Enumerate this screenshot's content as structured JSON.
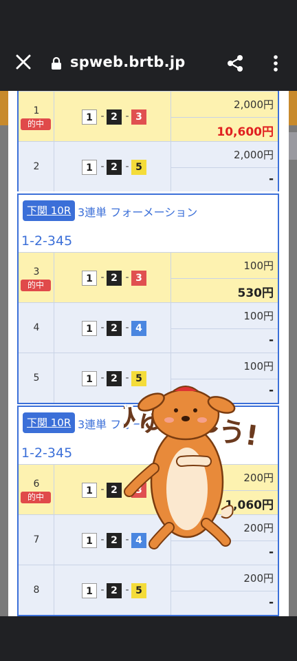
{
  "browser": {
    "domain": "spweb.brtb.jp",
    "close_icon": "close-icon",
    "lock_icon": "lock-icon",
    "share_icon": "share-icon",
    "more_icon": "more-vert-icon"
  },
  "colors": {
    "accent": "#3b6fd8",
    "hit_bg": "#fdf2b0",
    "nohit_bg": "#e9eef8",
    "hit_badge": "#e04a4a",
    "red_payout": "#e02020"
  },
  "groups": [
    {
      "race_button": "",
      "bet_type": "",
      "combo": "",
      "rows": [
        {
          "no": "1",
          "hit_label": "的中",
          "boxes": [
            "1",
            "2",
            "3"
          ],
          "bet": "2,000円",
          "payout": "10,600円"
        },
        {
          "no": "2",
          "hit_label": "",
          "boxes": [
            "1",
            "2",
            "5"
          ],
          "bet": "2,000円",
          "payout": "-"
        }
      ]
    },
    {
      "race_button": "下関 10R",
      "bet_type": "3連単 フォーメーション",
      "combo": "1-2-345",
      "rows": [
        {
          "no": "3",
          "hit_label": "的中",
          "boxes": [
            "1",
            "2",
            "3"
          ],
          "bet": "100円",
          "payout": "530円"
        },
        {
          "no": "4",
          "hit_label": "",
          "boxes": [
            "1",
            "2",
            "4"
          ],
          "bet": "100円",
          "payout": "-"
        },
        {
          "no": "5",
          "hit_label": "",
          "boxes": [
            "1",
            "2",
            "5"
          ],
          "bet": "100円",
          "payout": "-"
        }
      ]
    },
    {
      "race_button": "下関 10R",
      "bet_type": "3連単 フォーメ",
      "combo": "1-2-345",
      "rows": [
        {
          "no": "6",
          "hit_label": "的中",
          "boxes": [
            "1",
            "2",
            "3"
          ],
          "bet": "200円",
          "payout": "1,060円"
        },
        {
          "no": "7",
          "hit_label": "",
          "boxes": [
            "1",
            "2",
            "4"
          ],
          "bet": "200円",
          "payout": "-"
        },
        {
          "no": "8",
          "hit_label": "",
          "boxes": [
            "1",
            "2",
            "5"
          ],
          "bet": "200円",
          "payout": "-"
        }
      ]
    }
  ],
  "sticker": {
    "text": "ひゅ〜〜う!",
    "icon": "deer-sticker-icon"
  }
}
